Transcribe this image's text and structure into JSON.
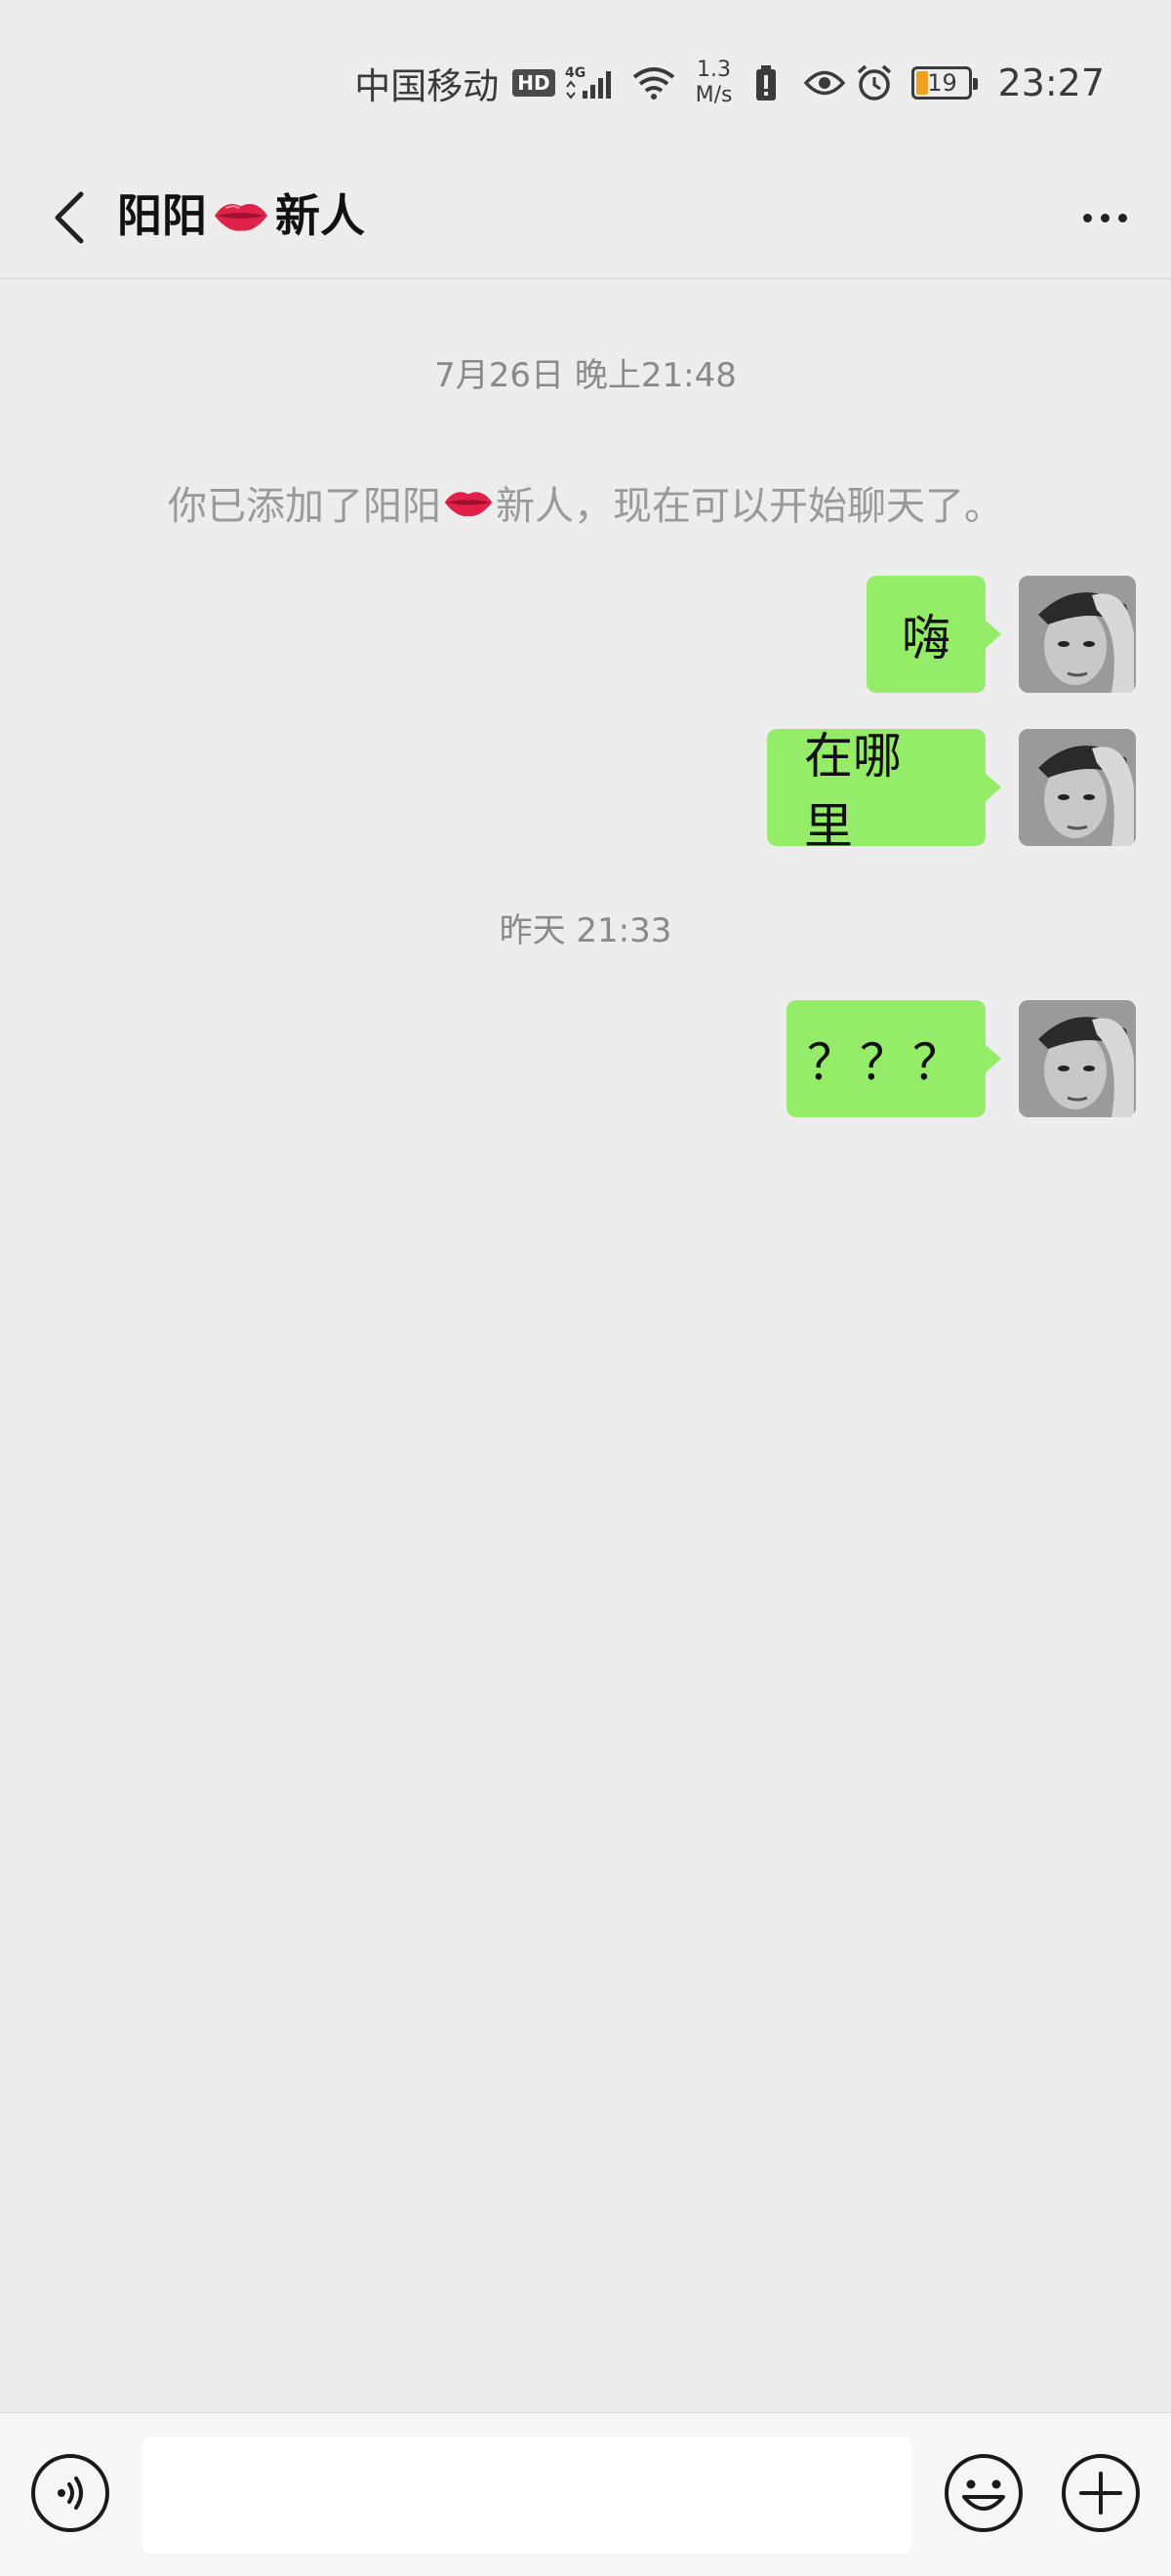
{
  "status_bar": {
    "carrier": "中国移动",
    "hd": "HD",
    "network": "4G",
    "speed_value": "1.3",
    "speed_unit": "M/s",
    "battery": "19",
    "time": "23:27",
    "icons": [
      "signal-icon",
      "wifi-icon",
      "battery-saver-icon",
      "eye-icon",
      "alarm-icon",
      "battery-icon"
    ]
  },
  "nav": {
    "title_part1": "阳阳",
    "title_part2": "新人",
    "back_icon": "chevron-left-icon",
    "more_icon": "more-dots-icon"
  },
  "chat": {
    "timestamp1": "7月26日 晚上21:48",
    "system_part1": "你已添加了阳阳",
    "system_part2": "新人，现在可以开始聊天了。",
    "messages": [
      {
        "text": "嗨"
      },
      {
        "text": "在哪里"
      },
      {
        "text": "？？？"
      }
    ],
    "timestamp2": "昨天 21:33"
  },
  "input_bar": {
    "voice_icon": "voice-icon",
    "emoji_icon": "emoji-icon",
    "plus_icon": "plus-icon",
    "placeholder": ""
  },
  "colors": {
    "background": "#ededed",
    "bubble": "#95ec69",
    "system_text": "#9a9a9a"
  }
}
